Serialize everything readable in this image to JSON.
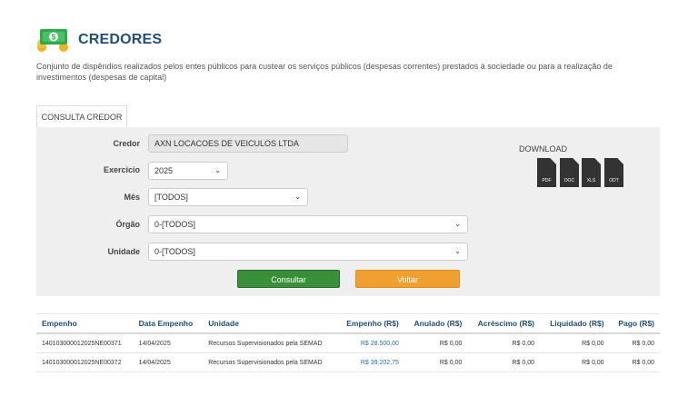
{
  "header": {
    "title": "CREDORES",
    "description": "Conjunto de dispêndios realizados pelos entes públicos para custear os serviços públicos (despesas correntes) prestados à sociedade ou para a realização de investimentos (despesas de capital)"
  },
  "tab": {
    "label": "CONSULTA CREDOR"
  },
  "form": {
    "credor_label": "Credor",
    "credor_value": "AXN LOCACOES DE VEICULOS LTDA",
    "exercicio_label": "Exercicio",
    "exercicio_value": "2025",
    "mes_label": "Mês",
    "mes_value": "[TODOS]",
    "orgao_label": "Órgão",
    "orgao_value": "0-[TODOS]",
    "unidade_label": "Unidade",
    "unidade_value": "0-[TODOS]",
    "consultar_label": "Consultar",
    "voltar_label": "Voltar"
  },
  "download": {
    "title": "DOWNLOAD",
    "files": [
      "PDF",
      "DOC",
      "XLS",
      "ODT"
    ]
  },
  "table": {
    "headers": [
      "Empenho",
      "Data Empenho",
      "Unidade",
      "Empenho (R$)",
      "Anulado (R$)",
      "Acréscimo (R$)",
      "Liquidado (R$)",
      "Pago (R$)"
    ],
    "rows": [
      [
        "140103000012025NE00371",
        "14/04/2025",
        "Recursos Supervisionados pela SEMAD",
        "R$ 28.500,00",
        "R$ 0,00",
        "R$ 0,00",
        "R$ 0,00",
        "R$ 0,00"
      ],
      [
        "140103000012025NE00372",
        "14/04/2025",
        "Recursos Supervisionados pela SEMAD",
        "R$ 39.202,75",
        "R$ 0,00",
        "R$ 0,00",
        "R$ 0,00",
        "R$ 0,00"
      ]
    ]
  },
  "colors": {
    "brand": "#1f4e79",
    "consultar": "#3a8f3a",
    "voltar": "#f0a030",
    "link": "#2a6db2",
    "logo_green": "#2faa4a",
    "logo_gold": "#f2b01e"
  }
}
